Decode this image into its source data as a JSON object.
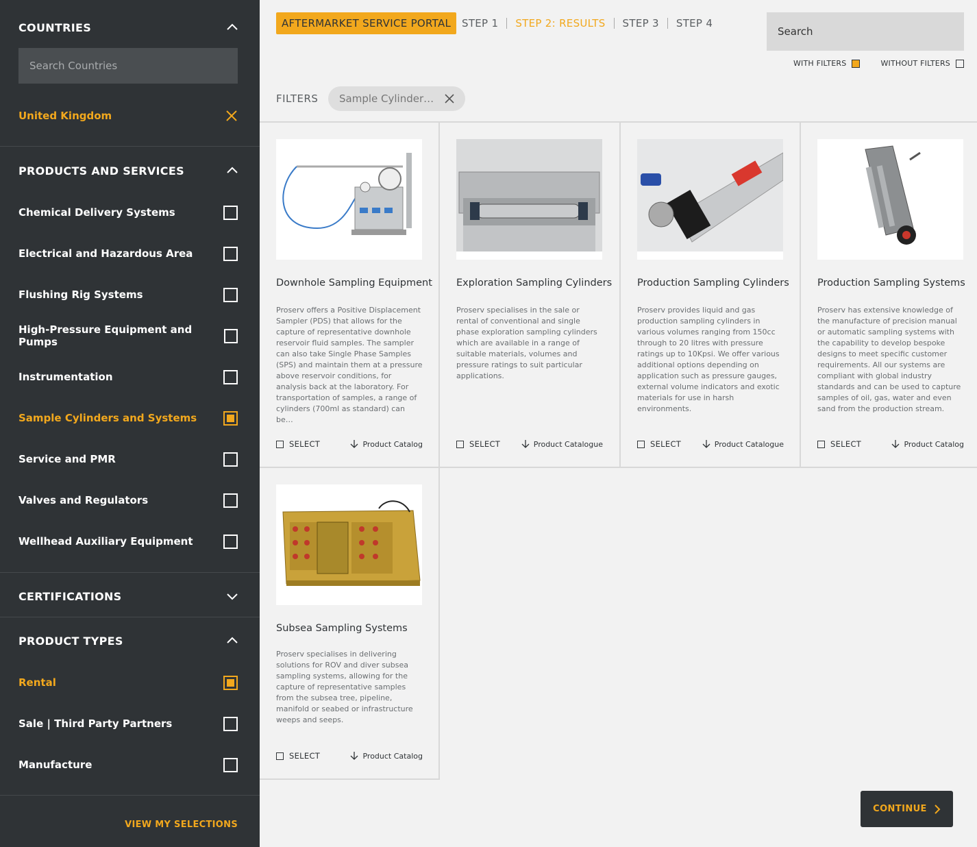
{
  "sidebar": {
    "countries": {
      "title": "COUNTRIES",
      "search_placeholder": "Search Countries",
      "selected": "United Kingdom"
    },
    "products": {
      "title": "PRODUCTS AND SERVICES",
      "items": [
        {
          "label": "Chemical Delivery Systems",
          "checked": false
        },
        {
          "label": "Electrical and Hazardous Area",
          "checked": false
        },
        {
          "label": "Flushing Rig Systems",
          "checked": false
        },
        {
          "label": "High-Pressure Equipment and Pumps",
          "checked": false
        },
        {
          "label": "Instrumentation",
          "checked": false
        },
        {
          "label": "Sample Cylinders and Systems",
          "checked": true
        },
        {
          "label": "Service and PMR",
          "checked": false
        },
        {
          "label": "Valves and Regulators",
          "checked": false
        },
        {
          "label": "Wellhead Auxiliary Equipment",
          "checked": false
        }
      ]
    },
    "certifications": {
      "title": "CERTIFICATIONS"
    },
    "product_types": {
      "title": "PRODUCT TYPES",
      "items": [
        {
          "label": "Rental",
          "checked": true
        },
        {
          "label": "Sale | Third Party Partners",
          "checked": false
        },
        {
          "label": "Manufacture",
          "checked": false
        }
      ]
    },
    "view_selections": "VIEW MY SELECTIONS"
  },
  "header": {
    "portal": "AFTERMARKET SERVICE PORTAL",
    "steps": [
      "STEP 1",
      "STEP 2: RESULTS",
      "STEP 3",
      "STEP 4"
    ],
    "current_step": 1,
    "search_placeholder": "Search",
    "with_filters": "WITH FILTERS",
    "without_filters": "WITHOUT FILTERS"
  },
  "filters": {
    "label": "FILTERS",
    "chip": "Sample Cylinder…"
  },
  "cards": [
    {
      "title": "Downhole Sampling Equipment",
      "desc": "Proserv offers a Positive Displacement Sampler (PDS) that allows for the capture of representative downhole reservoir fluid samples.  The sampler can also  take Single Phase Samples (SPS) and maintain them at a pressure above reservoir conditions, for analysis back at the laboratory. For transportation of samples, a range of cylinders (700ml as standard) can be…",
      "select": "SELECT",
      "catalog": "Product Catalog"
    },
    {
      "title": "Exploration Sampling Cylinders",
      "desc": "Proserv specialises in the sale or rental of conventional and single phase exploration sampling cylinders which are available in a range of suitable materials, volumes and pressure ratings to suit particular applications.",
      "select": "SELECT",
      "catalog": "Product Catalogue"
    },
    {
      "title": "Production Sampling Cylinders",
      "desc": "Proserv provides liquid and gas production sampling cylinders in various volumes ranging from 150cc through to 20 litres with pressure ratings up to 10Kpsi. We offer various additional options depending on application such as pressure gauges, external volume indicators and exotic materials for use in harsh environments.",
      "select": "SELECT",
      "catalog": "Product Catalogue"
    },
    {
      "title": "Production Sampling Systems",
      "desc": "Proserv has extensive knowledge of the manufacture of precision manual or automatic sampling systems with the capability to develop bespoke designs to meet specific customer requirements. All our systems are compliant with global industry standards and can be used to capture samples of oil, gas, water and even sand from the production stream.",
      "select": "SELECT",
      "catalog": "Product Catalog"
    },
    {
      "title": "Subsea Sampling Systems",
      "desc": "Proserv specialises in delivering solutions for ROV and diver subsea sampling systems, allowing for the capture of representative samples from the subsea tree, pipeline, manifold or seabed or infrastructure weeps and seeps.",
      "select": "SELECT",
      "catalog": "Product Catalog"
    }
  ],
  "continue": "CONTINUE",
  "colors": {
    "accent": "#f2a81d",
    "sidebar": "#2f3336",
    "page": "#f2f2f2"
  }
}
